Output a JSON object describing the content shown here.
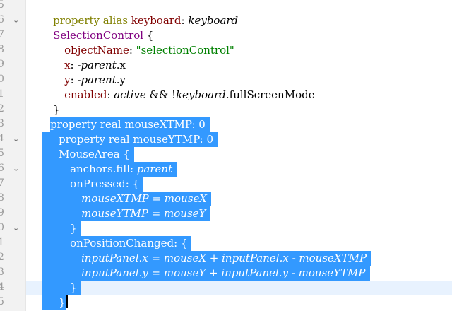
{
  "gutter": {
    "line_numbers": [
      "5",
      "6",
      "7",
      "8",
      "9",
      "0",
      "1",
      "2",
      "3",
      "4",
      "5",
      "6",
      "7",
      "8",
      "9",
      "0",
      "1",
      "2",
      "3",
      "4",
      "5"
    ]
  },
  "code": {
    "l0": {
      "t1": "property alias ",
      "t2": "keyboard",
      "t3": ": ",
      "t4": "keyboard"
    },
    "l1": {
      "t1": "SelectionControl",
      "t2": " {"
    },
    "l2": {
      "t1": "objectName",
      "t2": ": ",
      "t3": "\"selectionControl\""
    },
    "l3": {
      "t1": "x",
      "t2": ": -",
      "t3": "parent",
      "t4": ".x"
    },
    "l4": {
      "t1": "y",
      "t2": ": -",
      "t3": "parent",
      "t4": ".y"
    },
    "l5": {
      "t1": "enabled",
      "t2": ": ",
      "t3": "active",
      "t4": " && !",
      "t5": "keyboard",
      "t6": ".fullScreenMode"
    },
    "l6": {
      "t1": "}"
    },
    "l7": {
      "t1": "property real mouseXTMP: 0"
    },
    "l8": {
      "t1": "property real mouseYTMP: 0"
    },
    "l9": {
      "t1": "MouseArea {"
    },
    "l10": {
      "t1": "anchors.fill: ",
      "t2": "parent"
    },
    "l11": {
      "t1": "onPressed: {"
    },
    "l12": {
      "t1": "mouseXTMP = mouseX"
    },
    "l13": {
      "t1": "mouseYTMP = mouseY"
    },
    "l14": {
      "t1": "}"
    },
    "l15": {
      "t1": "onPositionChanged: {"
    },
    "l16": {
      "t1": "inputPanel.x = mouseX + inputPanel.x - mouseXTMP"
    },
    "l17": {
      "t1": "inputPanel.y = mouseY + inputPanel.y - mouseYTMP"
    },
    "l18": {
      "t1": "}"
    },
    "l19": {
      "t1": "}"
    }
  },
  "colors": {
    "selection": "#3399ff",
    "keyword": "#808000",
    "type": "#800080",
    "property": "#800000",
    "string": "#008000",
    "current_line": "#e8f2fe",
    "gutter": "#f2f2f2"
  },
  "icons": {
    "fold_marker": "chevron-down-icon"
  }
}
